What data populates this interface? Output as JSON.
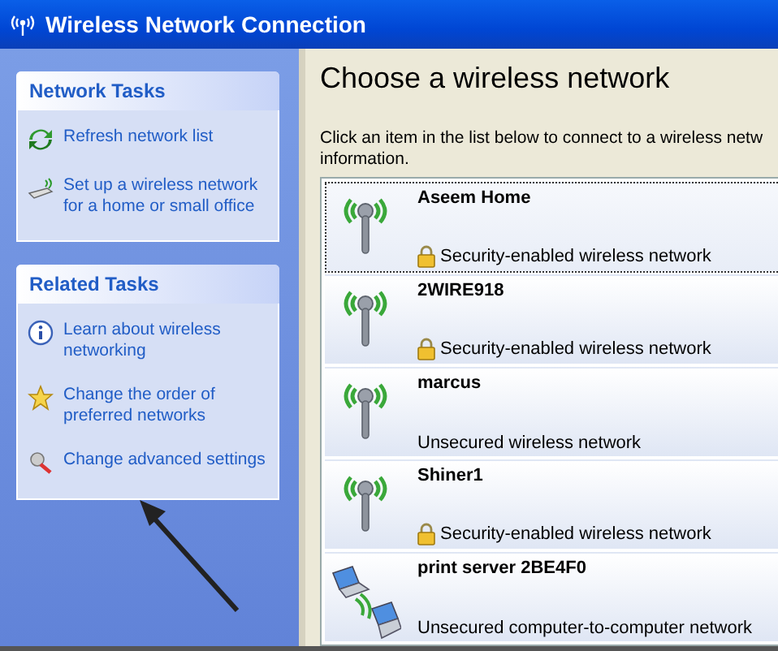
{
  "window": {
    "title": "Wireless Network Connection"
  },
  "sidebar": {
    "panels": [
      {
        "title": "Network Tasks",
        "items": [
          {
            "kind": "refresh",
            "label": "Refresh network list"
          },
          {
            "kind": "setup",
            "label": "Set up a wireless network for a home or small office"
          }
        ]
      },
      {
        "title": "Related Tasks",
        "items": [
          {
            "kind": "info",
            "label": "Learn about wireless networking"
          },
          {
            "kind": "star",
            "label": "Change the order of preferred networks"
          },
          {
            "kind": "settings",
            "label": "Change advanced settings"
          }
        ]
      }
    ]
  },
  "main": {
    "heading": "Choose a wireless network",
    "description": [
      "Click an item in the list below to connect to a wireless netw",
      "information."
    ],
    "networks": [
      {
        "kind": "wireless",
        "name": "Aseem Home",
        "secured": true,
        "status": "Security-enabled wireless network",
        "selected": true
      },
      {
        "kind": "wireless",
        "name": "2WIRE918",
        "secured": true,
        "status": "Security-enabled wireless network",
        "selected": false
      },
      {
        "kind": "wireless",
        "name": "marcus",
        "secured": false,
        "status": "Unsecured wireless network",
        "selected": false
      },
      {
        "kind": "wireless",
        "name": "Shiner1",
        "secured": true,
        "status": "Security-enabled wireless network",
        "selected": false
      },
      {
        "kind": "adhoc",
        "name": "print server 2BE4F0",
        "secured": false,
        "status": "Unsecured computer-to-computer network",
        "selected": false
      }
    ]
  }
}
